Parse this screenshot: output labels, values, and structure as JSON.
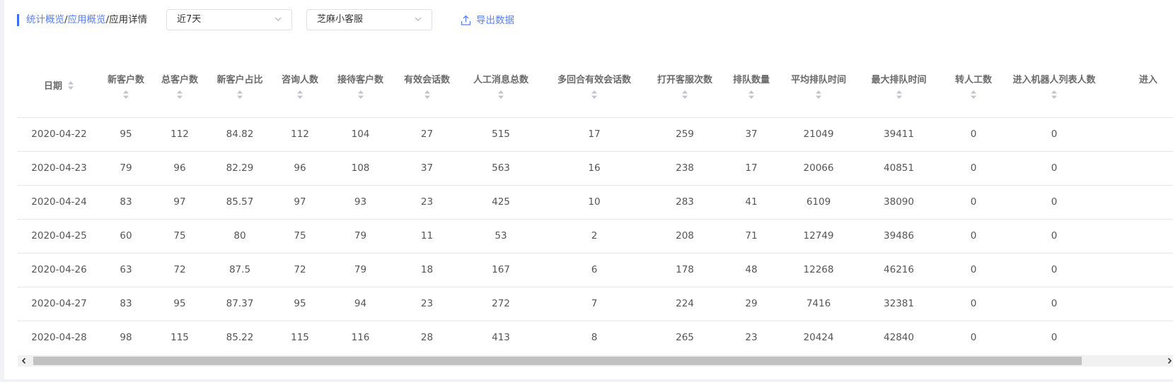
{
  "breadcrumb": {
    "items": [
      "统计概览",
      "应用概览"
    ],
    "separator": "/",
    "current": "应用详情"
  },
  "filters": {
    "date_range": "近7天",
    "app": "芝麻小客服"
  },
  "export_label": "导出数据",
  "table": {
    "headers": [
      "日期",
      "新客户数",
      "总客户数",
      "新客户占比",
      "咨询人数",
      "接待客户数",
      "有效会话数",
      "人工消息总数",
      "多回合有效会话数",
      "打开客服次数",
      "排队数量",
      "平均排队时间",
      "最大排队时间",
      "转人工数",
      "进入机器人列表人数",
      "进入"
    ],
    "rows": [
      [
        "2020-04-22",
        "95",
        "112",
        "84.82",
        "112",
        "104",
        "27",
        "515",
        "17",
        "259",
        "37",
        "21049",
        "39411",
        "0",
        "0",
        ""
      ],
      [
        "2020-04-23",
        "79",
        "96",
        "82.29",
        "96",
        "108",
        "37",
        "563",
        "16",
        "238",
        "17",
        "20066",
        "40851",
        "0",
        "0",
        ""
      ],
      [
        "2020-04-24",
        "83",
        "97",
        "85.57",
        "97",
        "93",
        "23",
        "425",
        "10",
        "283",
        "41",
        "6109",
        "38090",
        "0",
        "0",
        ""
      ],
      [
        "2020-04-25",
        "60",
        "75",
        "80",
        "75",
        "79",
        "11",
        "53",
        "2",
        "208",
        "71",
        "12749",
        "39486",
        "0",
        "0",
        ""
      ],
      [
        "2020-04-26",
        "63",
        "72",
        "87.5",
        "72",
        "79",
        "18",
        "167",
        "6",
        "178",
        "48",
        "12268",
        "46216",
        "0",
        "0",
        ""
      ],
      [
        "2020-04-27",
        "83",
        "95",
        "87.37",
        "95",
        "94",
        "23",
        "272",
        "7",
        "224",
        "29",
        "7416",
        "32381",
        "0",
        "0",
        ""
      ],
      [
        "2020-04-28",
        "98",
        "115",
        "85.22",
        "115",
        "116",
        "28",
        "413",
        "8",
        "265",
        "23",
        "20424",
        "42840",
        "0",
        "0",
        ""
      ]
    ]
  },
  "icons": {
    "select_chevron": "chevron-down-icon",
    "export": "upload-icon",
    "sort": "sort-icon",
    "scroll_left": "arrow-left-icon",
    "scroll_right": "arrow-right-icon"
  },
  "colors": {
    "accent": "#5b7ff0",
    "breadcrumb_bar": "#3b6cf6"
  }
}
